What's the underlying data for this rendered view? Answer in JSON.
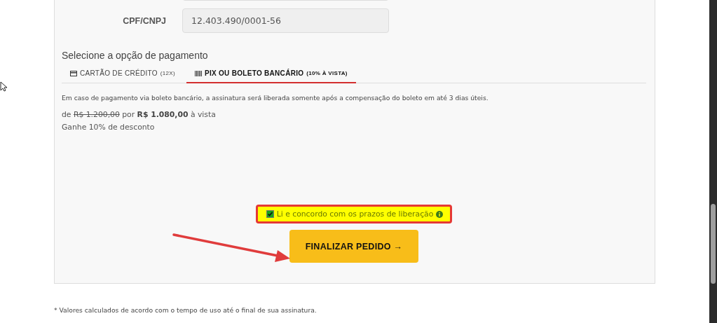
{
  "fields": [
    {
      "label": "CPF/CNPJ",
      "value": "12.403.490/0001-56"
    }
  ],
  "payment": {
    "heading": "Selecione a opção de pagamento",
    "tabs": [
      {
        "kind": "card",
        "label": "CARTÃO DE CRÉDITO",
        "note": "(12X)",
        "selected": false
      },
      {
        "kind": "barcode",
        "label": "PIX OU BOLETO BANCÁRIO",
        "note": "(10% À VISTA)",
        "selected": true
      }
    ],
    "notice": "Em caso de pagamento via boleto bancário, a assinatura será liberada somente após a compensação do boleto em até 3 dias úteis.",
    "price": {
      "prefix": "de",
      "old_price": "R$ 1.200,00",
      "middle": "por",
      "new_price": "R$ 1.080,00",
      "suffix": "à vista"
    },
    "discount": "Ganhe 10% de desconto"
  },
  "consent": {
    "label": "Li e concordo com os prazos de liberação",
    "checked": true
  },
  "submit": {
    "label": "FINALIZAR PEDIDO →"
  },
  "footnote": "* Valores calculados de acordo com o tempo de uso até o final de sua assinatura."
}
